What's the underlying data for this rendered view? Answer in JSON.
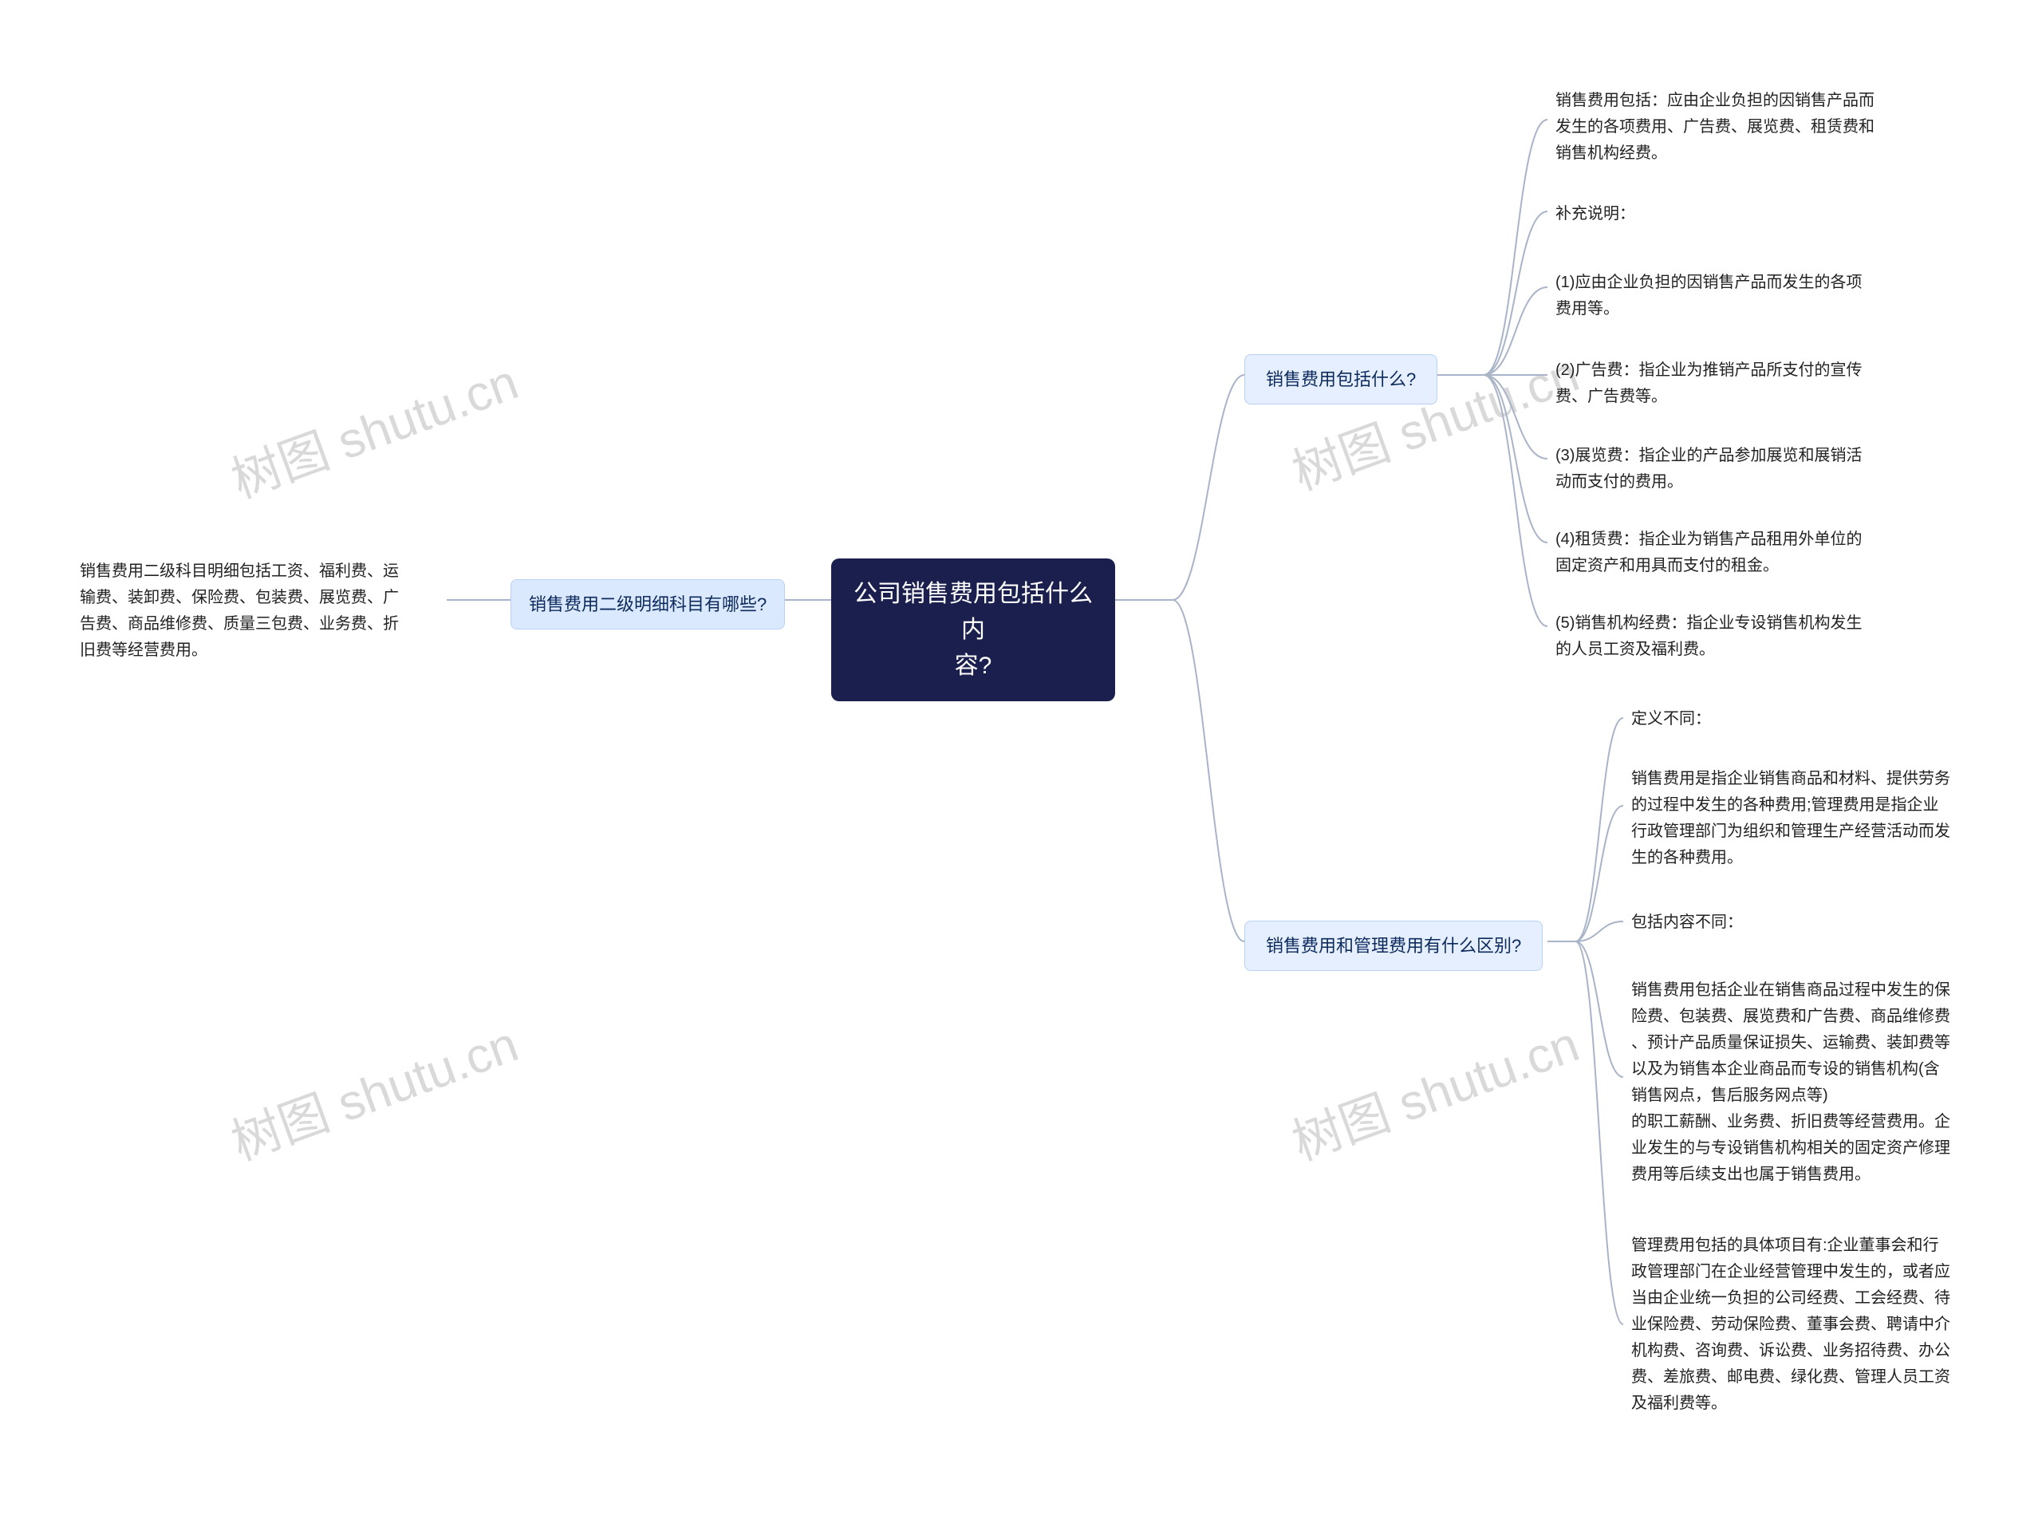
{
  "watermark": "树图 shutu.cn",
  "root": {
    "label": "公司销售费用包括什么内\n容?"
  },
  "left_branch": {
    "label": "销售费用二级明细科目有哪些?",
    "leaf": "销售费用二级科目明细包括工资、福利费、运\n输费、装卸费、保险费、包装费、展览费、广\n告费、商品维修费、质量三包费、业务费、折\n旧费等经营费用。"
  },
  "right_branches": [
    {
      "label": "销售费用包括什么?",
      "leaves": [
        "销售费用包括：应由企业负担的因销售产品而\n发生的各项费用、广告费、展览费、租赁费和\n销售机构经费。",
        "补充说明：",
        "(1)应由企业负担的因销售产品而发生的各项\n费用等。",
        "(2)广告费：指企业为推销产品所支付的宣传\n费、广告费等。",
        "(3)展览费：指企业的产品参加展览和展销活\n动而支付的费用。",
        "(4)租赁费：指企业为销售产品租用外单位的\n固定资产和用具而支付的租金。",
        "(5)销售机构经费：指企业专设销售机构发生\n的人员工资及福利费。"
      ]
    },
    {
      "label": "销售费用和管理费用有什么区别?",
      "leaves": [
        "定义不同：",
        "销售费用是指企业销售商品和材料、提供劳务\n的过程中发生的各种费用;管理费用是指企业\n行政管理部门为组织和管理生产经营活动而发\n生的各种费用。",
        "包括内容不同：",
        "销售费用包括企业在销售商品过程中发生的保\n险费、包装费、展览费和广告费、商品维修费\n、预计产品质量保证损失、运输费、装卸费等\n以及为销售本企业商品而专设的销售机构(含\n销售网点，售后服务网点等)\n的职工薪酬、业务费、折旧费等经营费用。企\n业发生的与专设销售机构相关的固定资产修理\n费用等后续支出也属于销售费用。",
        "管理费用包括的具体项目有:企业董事会和行\n政管理部门在企业经营管理中发生的，或者应\n当由企业统一负担的公司经费、工会经费、待\n业保险费、劳动保险费、董事会费、聘请中介\n机构费、咨询费、诉讼费、业务招待费、办公\n费、差旅费、邮电费、绿化费、管理人员工资\n及福利费等。"
      ]
    }
  ]
}
